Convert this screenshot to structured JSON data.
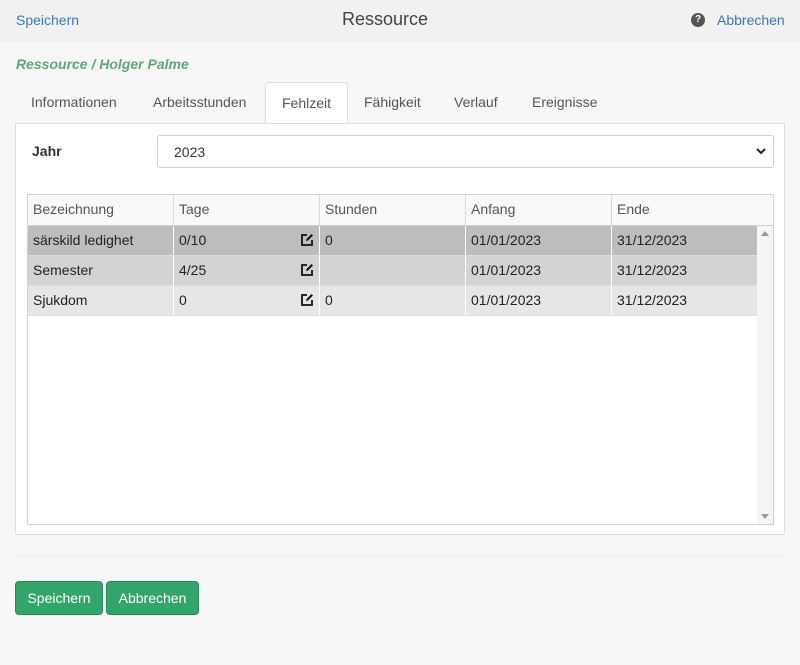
{
  "header": {
    "save_link": "Speichern",
    "title": "Ressource",
    "help_glyph": "?",
    "cancel_link": "Abbrechen"
  },
  "breadcrumb": "Ressource / Holger Palme",
  "tabs": [
    {
      "label": "Informationen",
      "active": false
    },
    {
      "label": "Arbeitsstunden",
      "active": false
    },
    {
      "label": "Fehlzeit",
      "active": true
    },
    {
      "label": "Fähigkeit",
      "active": false
    },
    {
      "label": "Verlauf",
      "active": false
    },
    {
      "label": "Ereignisse",
      "active": false
    }
  ],
  "year": {
    "label": "Jahr",
    "selected": "2023"
  },
  "table": {
    "columns": [
      "Bezeichnung",
      "Tage",
      "Stunden",
      "Anfang",
      "Ende"
    ],
    "rows": [
      {
        "name": "särskild ledighet",
        "days": "0/10",
        "hours": "0",
        "start": "01/01/2023",
        "end": "31/12/2023"
      },
      {
        "name": "Semester",
        "days": "4/25",
        "hours": "",
        "start": "01/01/2023",
        "end": "31/12/2023"
      },
      {
        "name": "Sjukdom",
        "days": "0",
        "hours": "0",
        "start": "01/01/2023",
        "end": "31/12/2023"
      }
    ]
  },
  "footer": {
    "save_button": "Speichern",
    "cancel_button": "Abbrechen"
  },
  "icons": {
    "help": "help-icon",
    "edit": "edit-icon",
    "dropdown": "chevron-down-icon"
  },
  "colors": {
    "link": "#3a79b8",
    "breadcrumb": "#5fa873",
    "button": "#33a46a"
  }
}
